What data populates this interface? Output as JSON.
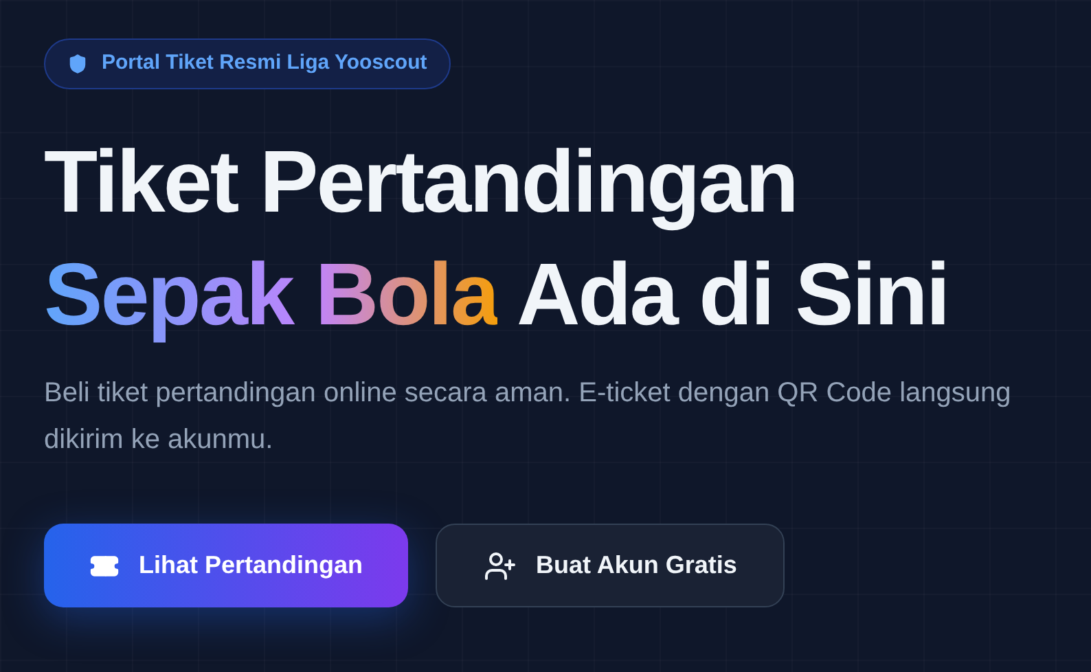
{
  "badge": {
    "label": "Portal Tiket Resmi Liga Yooscout"
  },
  "heading": {
    "line_1": "Tiket Pertandingan",
    "highlight": "Sepak Bola",
    "rest": "Ada di Sini"
  },
  "description": "Beli tiket pertandingan online secara aman. E-ticket dengan QR Code langsung dikirim ke akunmu.",
  "buttons": [
    {
      "label": "Lihat Pertandingan",
      "kind": "primary"
    },
    {
      "label": "Buat Akun Gratis",
      "kind": "secondary"
    }
  ]
}
